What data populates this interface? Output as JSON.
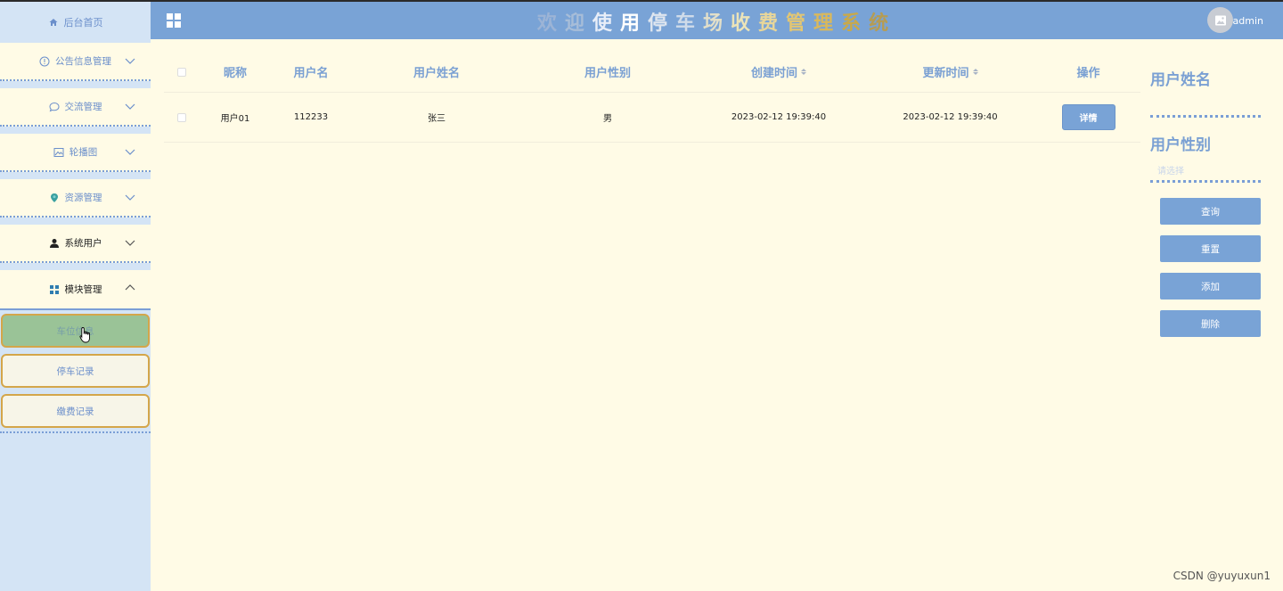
{
  "sidebar": {
    "home": "后台首页",
    "items": [
      {
        "label": "公告信息管理",
        "icon": "info-circle-icon",
        "expanded": false
      },
      {
        "label": "交流管理",
        "icon": "chat-bubble-icon",
        "expanded": false
      },
      {
        "label": "轮播图",
        "icon": "image-icon",
        "expanded": false
      },
      {
        "label": "资源管理",
        "icon": "location-pin-icon",
        "expanded": false
      },
      {
        "label": "系统用户",
        "icon": "user-icon",
        "expanded": false
      },
      {
        "label": "模块管理",
        "icon": "grid-icon",
        "expanded": true
      }
    ],
    "sub_items": [
      {
        "label": "车位信息",
        "active": true
      },
      {
        "label": "停车记录",
        "active": false
      },
      {
        "label": "缴费记录",
        "active": false
      }
    ]
  },
  "header": {
    "title_chars": [
      "欢",
      "迎",
      "使",
      "用",
      "停",
      "车",
      "场",
      "收",
      "费",
      "管",
      "理",
      "系",
      "统"
    ],
    "title_colors": [
      "#9cb4d6",
      "#a7bdd8",
      "#e8eef8",
      "#ffffff",
      "#dfe6ef",
      "#cfdbe9",
      "#e2dfc9",
      "#ece4b8",
      "#e8d69a",
      "#e2c673",
      "#d9b85c",
      "#c9a94a",
      "#b59c54"
    ],
    "user": "admin"
  },
  "table": {
    "headers": [
      "昵称",
      "用户名",
      "用户姓名",
      "用户性别",
      "创建时间",
      "更新时间",
      "操作"
    ],
    "rows": [
      {
        "nickname": "用户01",
        "username": "112233",
        "name": "张三",
        "gender": "男",
        "created": "2023-02-12 19:39:40",
        "updated": "2023-02-12 19:39:40",
        "action": "详情"
      }
    ]
  },
  "search_panel": {
    "field1_label": "用户姓名",
    "field2_label": "用户性别",
    "select_placeholder": "请选择",
    "buttons": [
      "查询",
      "重置",
      "添加",
      "删除"
    ]
  },
  "watermark": "CSDN @yuyuxun1",
  "colors": {
    "accent": "#79a3d6",
    "sidebar_bg": "#d4e4f5",
    "content_bg": "#fffbe6",
    "active_sub": "#9ac397"
  }
}
